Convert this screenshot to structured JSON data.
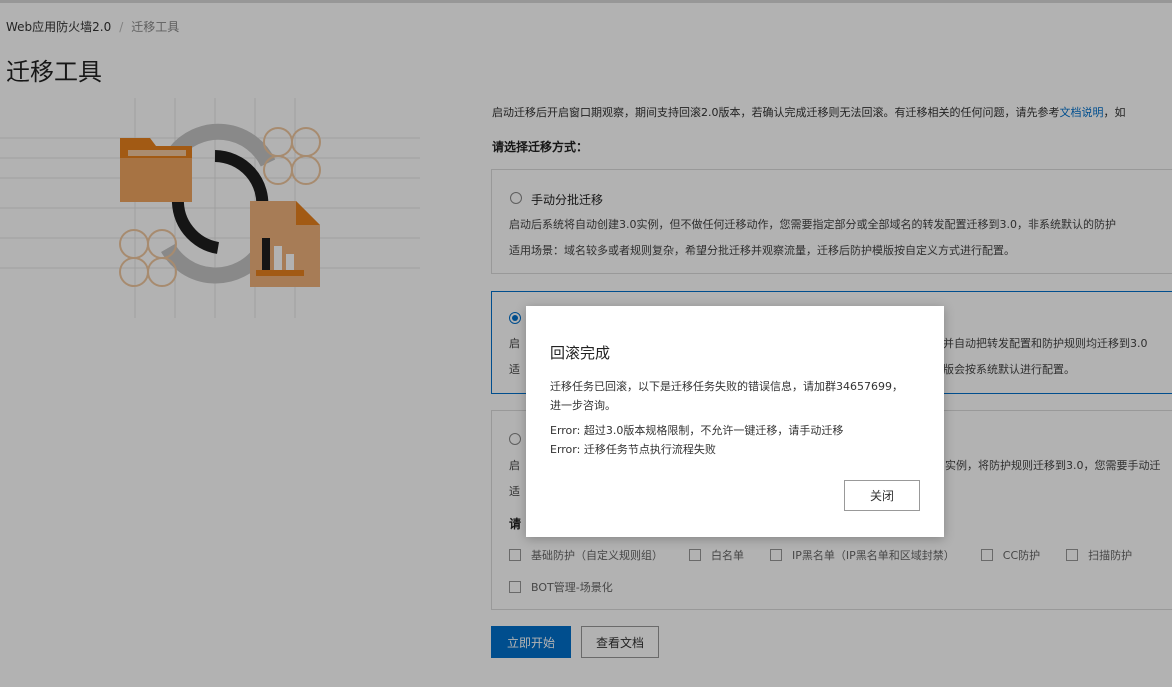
{
  "breadcrumb": {
    "root": "Web应用防火墙2.0",
    "separator": "/",
    "current": "迁移工具"
  },
  "page_title": "迁移工具",
  "intro": {
    "text": "启动迁移后开启窗口期观察，期间支持回滚2.0版本，若确认完成迁移则无法回滚。有迁移相关的任何问题，请先参考",
    "link": "文档说明",
    "tail": "，如"
  },
  "prompt": "请选择迁移方式：",
  "options": [
    {
      "title": "手动分批迁移",
      "selected": false,
      "line1": "启动后系统将自动创建3.0实例，但不做任何迁移动作，您需要指定部分或全部域名的转发配置迁移到3.0，非系统默认的防护",
      "line2": "适用场景：域名较多或者规则复杂，希望分批迁移并观察流量，迁移后防护模版按自定义方式进行配置。"
    },
    {
      "title": "",
      "selected": true,
      "line1_prefix": "启",
      "line1_suffix": "，并自动把转发配置和防护规则均迁移到3.0",
      "line2_prefix": "适",
      "line2_suffix": "模版会按系统默认进行配置。"
    },
    {
      "title": "",
      "selected": false,
      "line1_prefix": "启",
      "line1_suffix": "实例，将防护规则迁移到3.0，您需要手动迁",
      "line2_prefix": "适",
      "sub_prefix": "请"
    }
  ],
  "checkboxes_row1": [
    "基础防护（自定义规则组）",
    "白名单",
    "IP黑名单（IP黑名单和区域封禁）",
    "CC防护",
    "扫描防护"
  ],
  "checkboxes_row2": [
    "BOT管理-场景化"
  ],
  "buttons": {
    "start": "立即开始",
    "docs": "查看文档"
  },
  "modal": {
    "title": "回滚完成",
    "message": "迁移任务已回滚，以下是迁移任务失败的错误信息，请加群34657699，进一步咨询。",
    "errors": [
      "Error: 超过3.0版本规格限制，不允许一键迁移，请手动迁移",
      "Error: 迁移任务节点执行流程失败"
    ],
    "close": "关闭"
  },
  "colors": {
    "accent": "#0070cc",
    "illustration": "#e8821e",
    "illustration_dark": "#1f1f1f",
    "illustration_gray": "#b8b8b8"
  },
  "icons": [
    "folder-icon",
    "sync-arrows-icon",
    "document-chart-icon",
    "sparkle-decoration-icon"
  ]
}
